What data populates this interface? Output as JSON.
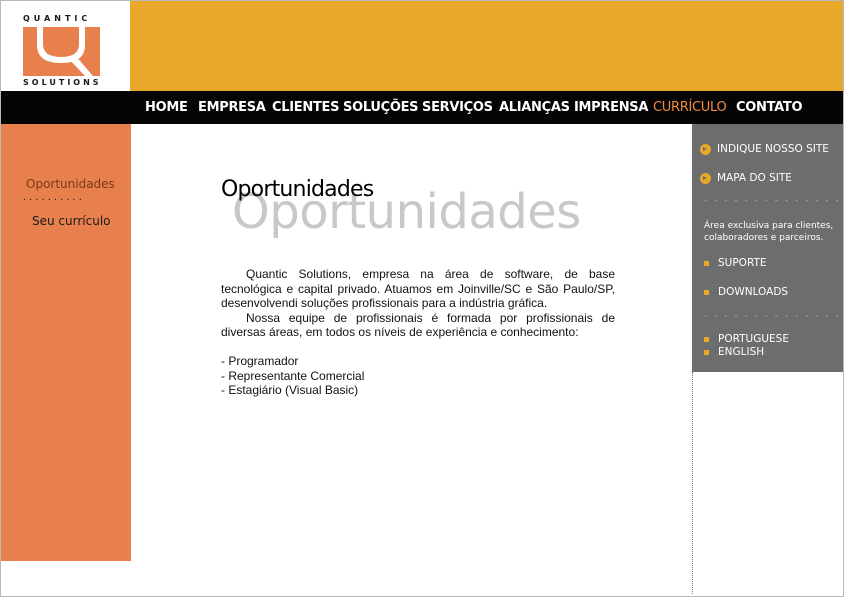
{
  "logo": {
    "top_text": "QUANTIC",
    "bottom_text": "SOLUTIONS"
  },
  "nav": {
    "items": [
      {
        "label": "HOME"
      },
      {
        "label": "EMPRESA"
      },
      {
        "label": "CLIENTES"
      },
      {
        "label": "SOLUÇÕES"
      },
      {
        "label": "SERVIÇOS"
      },
      {
        "label": "ALIANÇAS"
      },
      {
        "label": "IMPRENSA"
      },
      {
        "label": "CURRÍCULO",
        "active": true
      },
      {
        "label": "CONTATO"
      }
    ],
    "active_color": "#f08a45"
  },
  "left_sidebar": {
    "title": "Oportunidades",
    "divider": "..........",
    "link": "Seu currículo"
  },
  "main": {
    "watermark": "Oportunidades",
    "title": "Oportunidades",
    "paragraph1": "Quantic Solutions, empresa na área de software, de base tecnológica e capital privado. Atuamos em Joinville/SC e São Paulo/SP, desenvolvendi soluções profissionais para a indústria gráfica.",
    "paragraph2": "Nossa equipe de profissionais é formada por profissionais de diversas áreas, em todos os níveis de experiência e conhecimento:",
    "jobs": [
      "- Programador",
      "- Representante Comercial",
      "- Estagiário (Visual Basic)"
    ]
  },
  "right_sidebar": {
    "link1": "INDIQUE NOSSO SITE",
    "link2": "MAPA DO SITE",
    "dashes": "- - - - - - - - - - - - - -",
    "note": "Área exclusiva para clientes, colaboradores e parceiros.",
    "link3": "SUPORTE",
    "link4": "DOWNLOADS",
    "lang1": "PORTUGUESE",
    "lang2": "ENGLISH"
  },
  "colors": {
    "brand_orange": "#e8a92a",
    "sidebar_orange": "#e7804c",
    "sidebar_gray": "#6d6d6d",
    "nav_black": "#050505"
  }
}
